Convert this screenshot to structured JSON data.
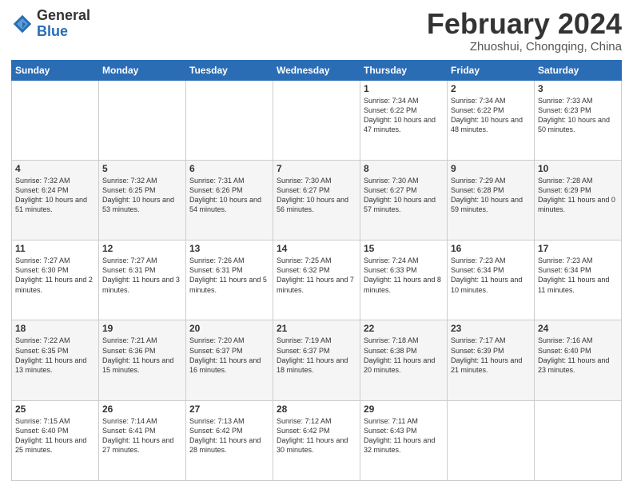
{
  "header": {
    "logo_general": "General",
    "logo_blue": "Blue",
    "calendar_title": "February 2024",
    "calendar_subtitle": "Zhuoshui, Chongqing, China"
  },
  "days_of_week": [
    "Sunday",
    "Monday",
    "Tuesday",
    "Wednesday",
    "Thursday",
    "Friday",
    "Saturday"
  ],
  "weeks": [
    [
      {
        "day": "",
        "info": ""
      },
      {
        "day": "",
        "info": ""
      },
      {
        "day": "",
        "info": ""
      },
      {
        "day": "",
        "info": ""
      },
      {
        "day": "1",
        "info": "Sunrise: 7:34 AM\nSunset: 6:22 PM\nDaylight: 10 hours and 47 minutes."
      },
      {
        "day": "2",
        "info": "Sunrise: 7:34 AM\nSunset: 6:22 PM\nDaylight: 10 hours and 48 minutes."
      },
      {
        "day": "3",
        "info": "Sunrise: 7:33 AM\nSunset: 6:23 PM\nDaylight: 10 hours and 50 minutes."
      }
    ],
    [
      {
        "day": "4",
        "info": "Sunrise: 7:32 AM\nSunset: 6:24 PM\nDaylight: 10 hours and 51 minutes."
      },
      {
        "day": "5",
        "info": "Sunrise: 7:32 AM\nSunset: 6:25 PM\nDaylight: 10 hours and 53 minutes."
      },
      {
        "day": "6",
        "info": "Sunrise: 7:31 AM\nSunset: 6:26 PM\nDaylight: 10 hours and 54 minutes."
      },
      {
        "day": "7",
        "info": "Sunrise: 7:30 AM\nSunset: 6:27 PM\nDaylight: 10 hours and 56 minutes."
      },
      {
        "day": "8",
        "info": "Sunrise: 7:30 AM\nSunset: 6:27 PM\nDaylight: 10 hours and 57 minutes."
      },
      {
        "day": "9",
        "info": "Sunrise: 7:29 AM\nSunset: 6:28 PM\nDaylight: 10 hours and 59 minutes."
      },
      {
        "day": "10",
        "info": "Sunrise: 7:28 AM\nSunset: 6:29 PM\nDaylight: 11 hours and 0 minutes."
      }
    ],
    [
      {
        "day": "11",
        "info": "Sunrise: 7:27 AM\nSunset: 6:30 PM\nDaylight: 11 hours and 2 minutes."
      },
      {
        "day": "12",
        "info": "Sunrise: 7:27 AM\nSunset: 6:31 PM\nDaylight: 11 hours and 3 minutes."
      },
      {
        "day": "13",
        "info": "Sunrise: 7:26 AM\nSunset: 6:31 PM\nDaylight: 11 hours and 5 minutes."
      },
      {
        "day": "14",
        "info": "Sunrise: 7:25 AM\nSunset: 6:32 PM\nDaylight: 11 hours and 7 minutes."
      },
      {
        "day": "15",
        "info": "Sunrise: 7:24 AM\nSunset: 6:33 PM\nDaylight: 11 hours and 8 minutes."
      },
      {
        "day": "16",
        "info": "Sunrise: 7:23 AM\nSunset: 6:34 PM\nDaylight: 11 hours and 10 minutes."
      },
      {
        "day": "17",
        "info": "Sunrise: 7:23 AM\nSunset: 6:34 PM\nDaylight: 11 hours and 11 minutes."
      }
    ],
    [
      {
        "day": "18",
        "info": "Sunrise: 7:22 AM\nSunset: 6:35 PM\nDaylight: 11 hours and 13 minutes."
      },
      {
        "day": "19",
        "info": "Sunrise: 7:21 AM\nSunset: 6:36 PM\nDaylight: 11 hours and 15 minutes."
      },
      {
        "day": "20",
        "info": "Sunrise: 7:20 AM\nSunset: 6:37 PM\nDaylight: 11 hours and 16 minutes."
      },
      {
        "day": "21",
        "info": "Sunrise: 7:19 AM\nSunset: 6:37 PM\nDaylight: 11 hours and 18 minutes."
      },
      {
        "day": "22",
        "info": "Sunrise: 7:18 AM\nSunset: 6:38 PM\nDaylight: 11 hours and 20 minutes."
      },
      {
        "day": "23",
        "info": "Sunrise: 7:17 AM\nSunset: 6:39 PM\nDaylight: 11 hours and 21 minutes."
      },
      {
        "day": "24",
        "info": "Sunrise: 7:16 AM\nSunset: 6:40 PM\nDaylight: 11 hours and 23 minutes."
      }
    ],
    [
      {
        "day": "25",
        "info": "Sunrise: 7:15 AM\nSunset: 6:40 PM\nDaylight: 11 hours and 25 minutes."
      },
      {
        "day": "26",
        "info": "Sunrise: 7:14 AM\nSunset: 6:41 PM\nDaylight: 11 hours and 27 minutes."
      },
      {
        "day": "27",
        "info": "Sunrise: 7:13 AM\nSunset: 6:42 PM\nDaylight: 11 hours and 28 minutes."
      },
      {
        "day": "28",
        "info": "Sunrise: 7:12 AM\nSunset: 6:42 PM\nDaylight: 11 hours and 30 minutes."
      },
      {
        "day": "29",
        "info": "Sunrise: 7:11 AM\nSunset: 6:43 PM\nDaylight: 11 hours and 32 minutes."
      },
      {
        "day": "",
        "info": ""
      },
      {
        "day": "",
        "info": ""
      }
    ]
  ]
}
